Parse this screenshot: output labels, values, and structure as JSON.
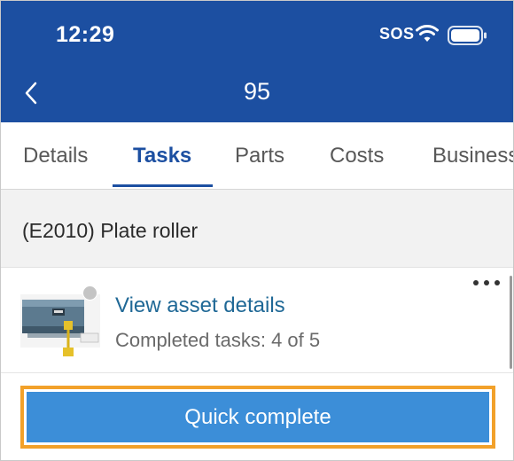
{
  "status_bar": {
    "time": "12:29",
    "sos": "SOS",
    "icons": [
      "wifi-icon",
      "battery-icon"
    ]
  },
  "header": {
    "back_icon": "chevron-left-icon",
    "title": "95",
    "color": "#1c4fa1"
  },
  "tabs": [
    {
      "label": "Details",
      "active": false
    },
    {
      "label": "Tasks",
      "active": true
    },
    {
      "label": "Parts",
      "active": false
    },
    {
      "label": "Costs",
      "active": false
    },
    {
      "label": "Business",
      "active": false
    }
  ],
  "section": {
    "title": "(E2010) Plate roller"
  },
  "asset": {
    "link_label": "View asset details",
    "progress_text": "Completed tasks: 4 of 5",
    "completed": 4,
    "total": 5,
    "more_icon": "more-horizontal-icon",
    "thumbnail_icon": "plate-roller-thumbnail"
  },
  "quick_complete": {
    "label": "Quick complete",
    "color": "#3c8ed8",
    "highlight_color": "#f2a12a"
  }
}
